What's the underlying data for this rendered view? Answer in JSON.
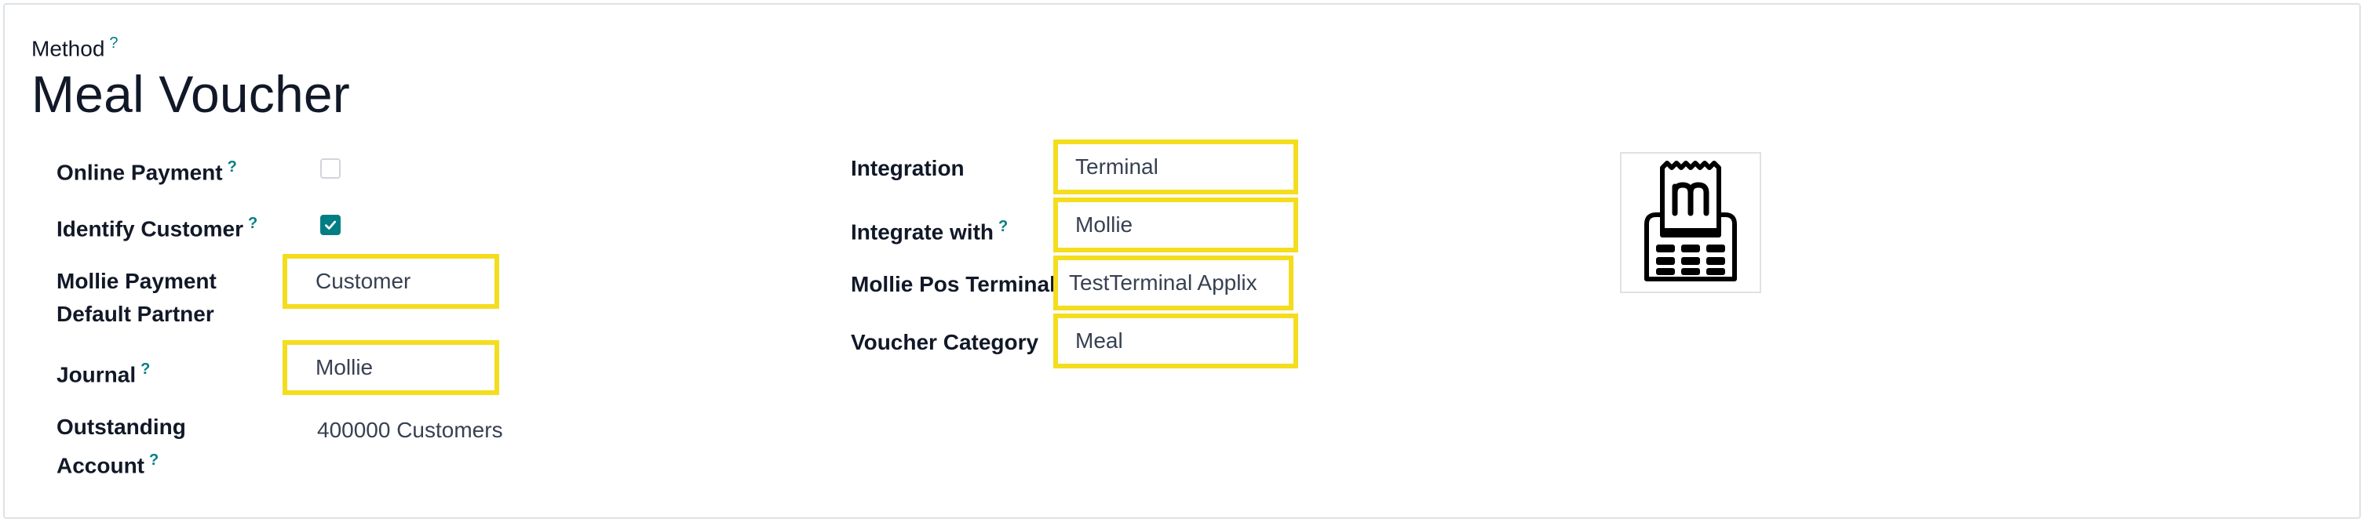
{
  "header": {
    "method_label": "Method",
    "help_mark": "?",
    "title": "Meal Voucher"
  },
  "left": {
    "online_payment": {
      "label": "Online Payment",
      "checked": false
    },
    "identify_customer": {
      "label": "Identify Customer",
      "checked": true
    },
    "mollie_default_partner": {
      "label_line1": "Mollie Payment",
      "label_line2": "Default Partner",
      "value": "Customer"
    },
    "journal": {
      "label": "Journal",
      "value": "Mollie"
    },
    "outstanding_account": {
      "label_line1": "Outstanding",
      "label_line2": "Account",
      "value": "400000 Customers"
    }
  },
  "right": {
    "integration": {
      "label": "Integration",
      "value": "Terminal"
    },
    "integrate_with": {
      "label": "Integrate with",
      "value": "Mollie"
    },
    "pos_terminal": {
      "label": "Mollie Pos Terminal",
      "value": "TestTerminal Applix"
    },
    "voucher_category": {
      "label": "Voucher Category",
      "value": "Meal"
    }
  },
  "image": {
    "icon": "mollie-pos-terminal-icon"
  },
  "colors": {
    "highlight": "#f4dd1e",
    "accent": "#017e84",
    "border": "#dee2e6"
  }
}
